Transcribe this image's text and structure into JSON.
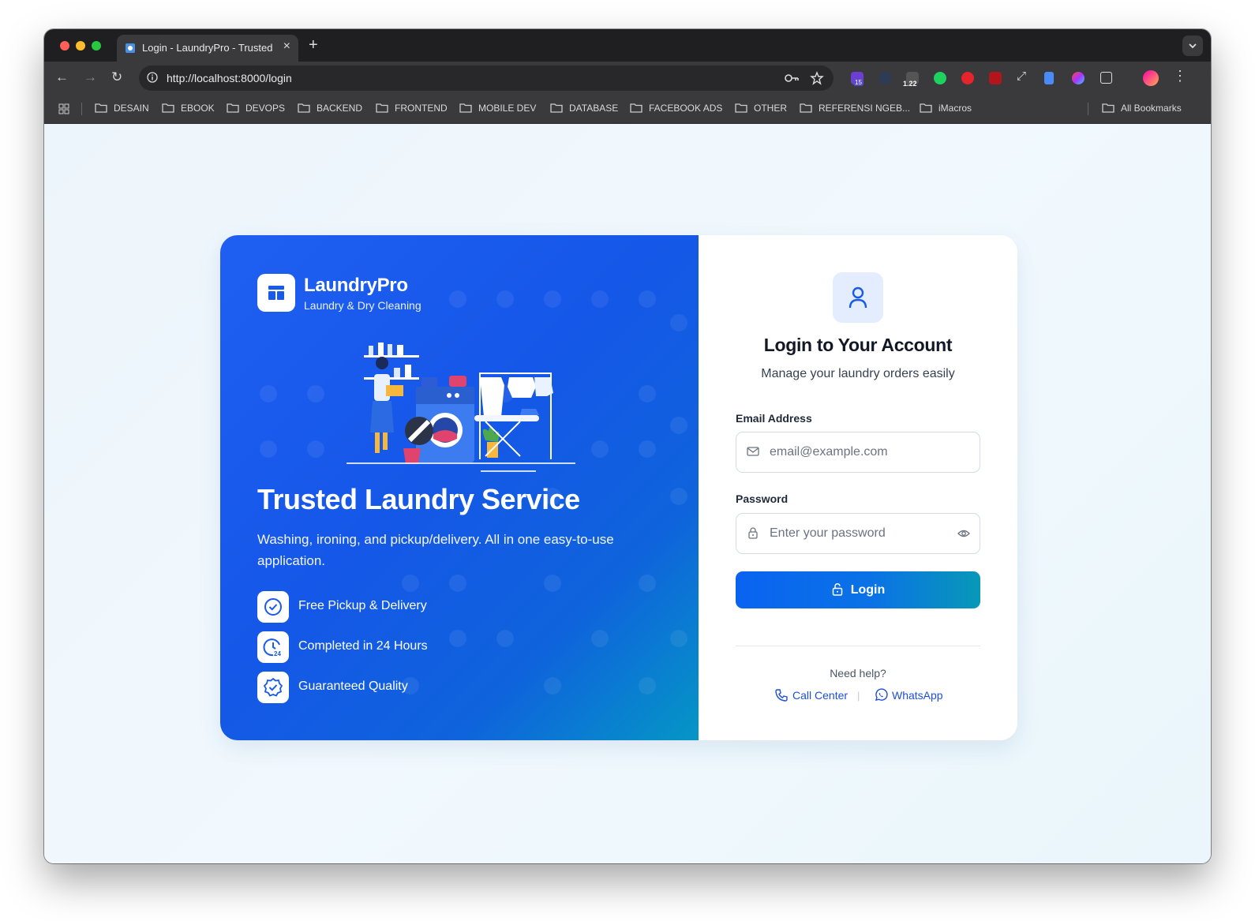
{
  "browser": {
    "tab_title": "Login - LaundryPro - Trusted",
    "url": "http://localhost:8000/login",
    "extension_badges": [
      "15",
      "1.22"
    ],
    "bookmarks": [
      "DESAIN",
      "EBOOK",
      "DEVOPS",
      "BACKEND",
      "FRONTEND",
      "MOBILE DEV",
      "DATABASE",
      "FACEBOOK ADS",
      "OTHER",
      "REFERENSI NGEB...",
      "iMacros"
    ],
    "all_bookmarks": "All Bookmarks"
  },
  "brand": {
    "name": "LaundryPro",
    "tagline": "Laundry & Dry Cleaning"
  },
  "hero": {
    "headline": "Trusted Laundry Service",
    "description": "Washing, ironing, and pickup/delivery. All in one easy-to-use application.",
    "features": [
      "Free Pickup & Delivery",
      "Completed in 24 Hours",
      "Guaranteed Quality"
    ]
  },
  "login": {
    "title": "Login to Your Account",
    "subtitle": "Manage your laundry orders easily",
    "email_label": "Email Address",
    "email_placeholder": "email@example.com",
    "password_label": "Password",
    "password_placeholder": "Enter your password",
    "button_label": "Login"
  },
  "help": {
    "prompt": "Need help?",
    "call_center": "Call Center",
    "separator": "|",
    "whatsapp": "WhatsApp"
  },
  "colors": {
    "primary": "#1557e8",
    "accent_teal": "#0898b8",
    "link": "#1d4ed8"
  }
}
